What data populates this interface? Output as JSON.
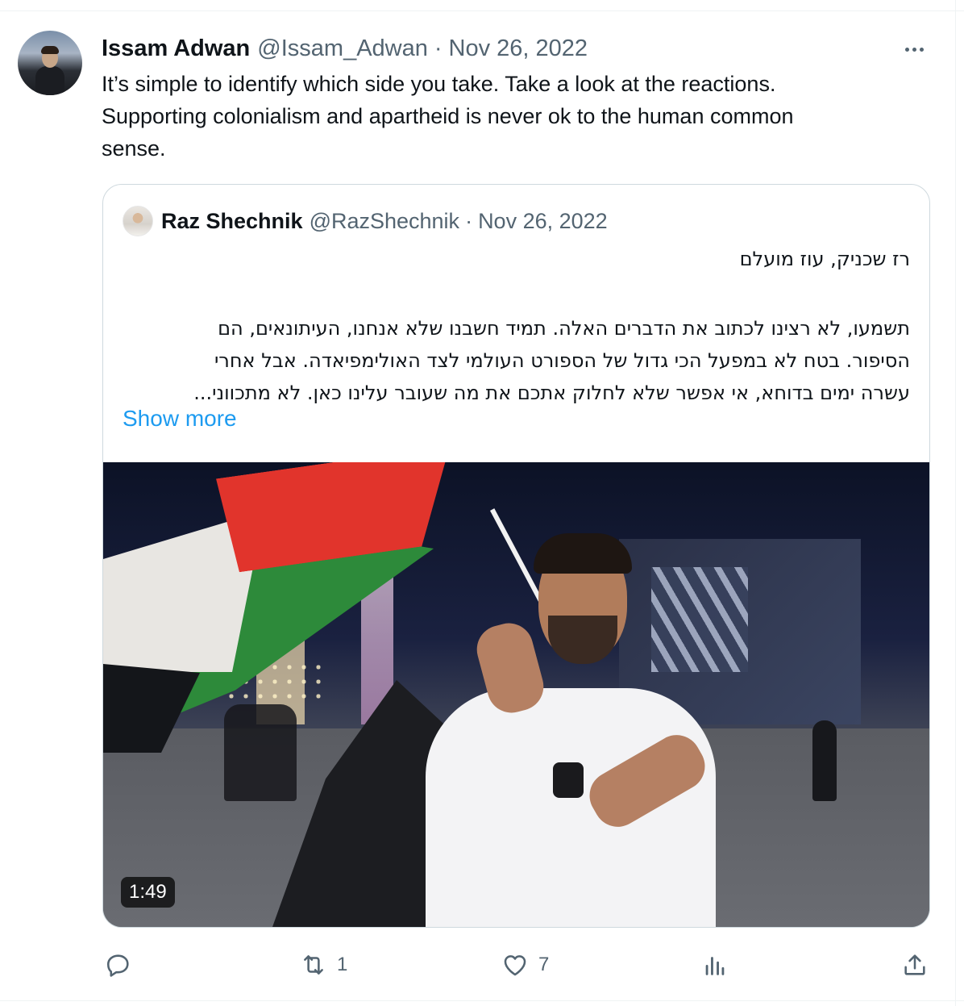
{
  "tweet": {
    "author_name": "Issam Adwan",
    "author_handle": "@Issam_Adwan",
    "separator": "·",
    "date": "Nov 26, 2022",
    "text": "It’s simple to identify which side you take. Take a look at the reactions.\nSupporting colonialism and apartheid is never ok to the human common\nsense."
  },
  "quote": {
    "author_name": "Raz Shechnik",
    "author_handle": "@RazShechnik",
    "separator": "·",
    "date": "Nov 26, 2022",
    "title_line": "רז שכניק, עוז מועלם",
    "body_lines": [
      "תשמעו, לא רצינו לכתוב את הדברים האלה. תמיד חשבנו שלא אנחנו, העיתונאים, הם",
      "הסיפור. בטח לא במפעל הכי גדול של הספורט העולמי לצד האולימפיאדה. אבל אחרי",
      "עשרה ימים בדוחא, אי אפשר שלא לחלוק אתכם את מה שעובר עלינו כאן. לא מתכווני..."
    ],
    "show_more": "Show more",
    "video_duration": "1:49"
  },
  "actions": {
    "reply": {
      "icon": "reply-icon",
      "count": ""
    },
    "retweet": {
      "icon": "retweet-icon",
      "count": "1"
    },
    "like": {
      "icon": "heart-icon",
      "count": "7"
    },
    "views": {
      "icon": "views-icon",
      "count": ""
    },
    "share": {
      "icon": "share-icon",
      "count": ""
    }
  },
  "colors": {
    "text_primary": "#0f1419",
    "text_secondary": "#536471",
    "link": "#1d9bf0",
    "border": "#cfd9de"
  }
}
